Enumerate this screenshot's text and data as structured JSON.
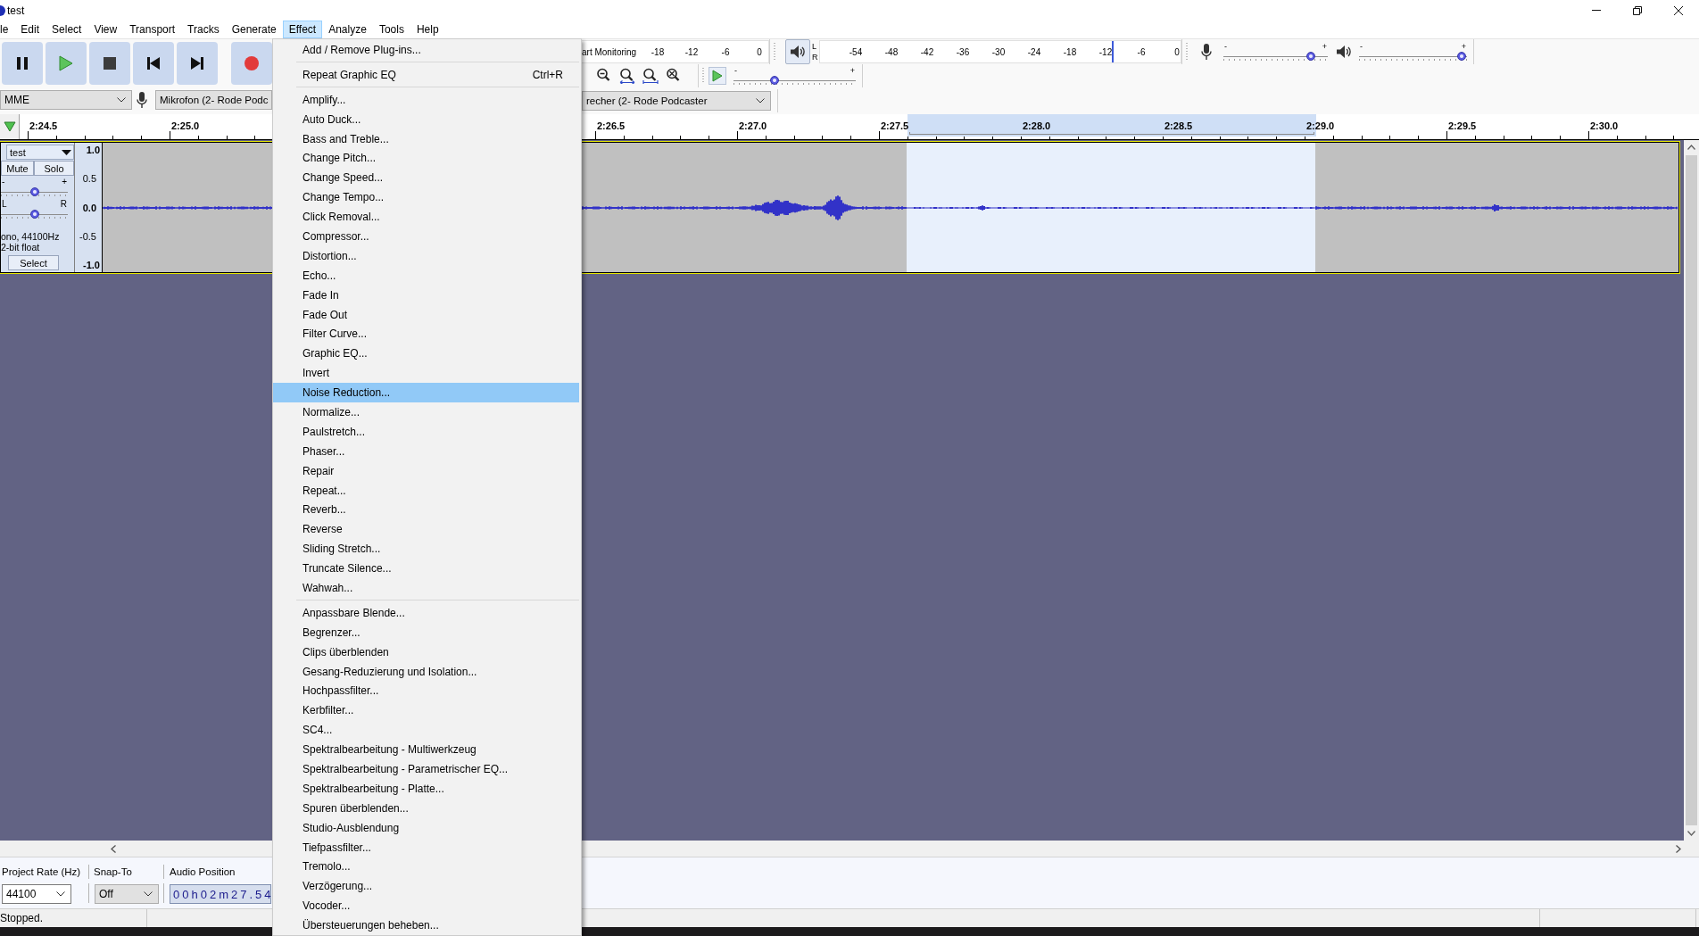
{
  "window": {
    "title": "test"
  },
  "menu_bar": [
    {
      "label": "le",
      "selected": false
    },
    {
      "label": "Edit",
      "selected": false
    },
    {
      "label": "Select",
      "selected": false
    },
    {
      "label": "View",
      "selected": false
    },
    {
      "label": "Transport",
      "selected": false
    },
    {
      "label": "Tracks",
      "selected": false
    },
    {
      "label": "Generate",
      "selected": false
    },
    {
      "label": "Effect",
      "selected": true
    },
    {
      "label": "Analyze",
      "selected": false
    },
    {
      "label": "Tools",
      "selected": false
    },
    {
      "label": "Help",
      "selected": false
    }
  ],
  "meter_toolbar": {
    "recording": {
      "label": "art Monitoring",
      "ticks": [
        "-18",
        "-12",
        "-6",
        "0"
      ]
    },
    "playback": {
      "channels": [
        "L",
        "R"
      ],
      "ticks": [
        "-54",
        "-48",
        "-42",
        "-36",
        "-30",
        "-24",
        "-18",
        "-12",
        "-6",
        "0"
      ],
      "level": 0.81
    }
  },
  "mixer_toolbar": {
    "recording_volume": {
      "min_label": "-",
      "max_label": "+",
      "level": 0.87
    },
    "playback_volume": {
      "min_label": "-",
      "max_label": "+",
      "level": 0.99
    }
  },
  "play_at_speed": {
    "min_label": "-",
    "max_label": "+",
    "level": 0.32
  },
  "device_toolbar": {
    "host": "MME",
    "recording_device": "Mikrofon (2- Rode Podc",
    "playback_device": "recher (2- Rode Podcaster"
  },
  "ruler": {
    "labels_left": [
      "2:24.5",
      "2:25.0"
    ],
    "labels_right": [
      "2:26.5",
      "2:27.0",
      "2:27.5",
      "2:28.0",
      "2:28.5",
      "2:29.0",
      "2:29.5",
      "2:30.0"
    ]
  },
  "track": {
    "name": "test",
    "selected": true,
    "mute_button": "Mute",
    "solo_button": "Solo",
    "gain": {
      "min_label": "-",
      "max_label": "+",
      "level": 0.5
    },
    "pan": {
      "min_label": "L",
      "max_label": "R",
      "level": 0.5
    },
    "info": [
      "ono, 44100Hz",
      "2-bit float"
    ],
    "select_button": "Select",
    "scale": [
      {
        "label": "1.0",
        "major": true
      },
      {
        "label": "0.5",
        "major": false
      },
      {
        "label": "0.0",
        "major": true
      },
      {
        "label": "-0.5",
        "major": false
      },
      {
        "label": "-1.0",
        "major": true
      }
    ]
  },
  "selection_toolbar": {
    "project_rate": {
      "label": "Project Rate (Hz)",
      "value": "44100"
    },
    "snap_to": {
      "label": "Snap-To",
      "value": "Off"
    },
    "audio_position": {
      "label": "Audio Position",
      "value": "00h02m27.54"
    }
  },
  "status_bar": {
    "text": "Stopped."
  },
  "effect_menu": {
    "sections": [
      {
        "items": [
          {
            "label": "Add / Remove Plug-ins...",
            "selected": false
          }
        ]
      },
      {
        "items": [
          {
            "label": "Repeat Graphic EQ",
            "shortcut": "Ctrl+R",
            "selected": false
          }
        ]
      },
      {
        "items": [
          {
            "label": "Amplify...",
            "selected": false
          },
          {
            "label": "Auto Duck...",
            "selected": false
          },
          {
            "label": "Bass and Treble...",
            "selected": false
          },
          {
            "label": "Change Pitch...",
            "selected": false
          },
          {
            "label": "Change Speed...",
            "selected": false
          },
          {
            "label": "Change Tempo...",
            "selected": false
          },
          {
            "label": "Click Removal...",
            "selected": false
          },
          {
            "label": "Compressor...",
            "selected": false
          },
          {
            "label": "Distortion...",
            "selected": false
          },
          {
            "label": "Echo...",
            "selected": false
          },
          {
            "label": "Fade In",
            "selected": false
          },
          {
            "label": "Fade Out",
            "selected": false
          },
          {
            "label": "Filter Curve...",
            "selected": false
          },
          {
            "label": "Graphic EQ...",
            "selected": false
          },
          {
            "label": "Invert",
            "selected": false
          },
          {
            "label": "Noise Reduction...",
            "selected": true
          },
          {
            "label": "Normalize...",
            "selected": false
          },
          {
            "label": "Paulstretch...",
            "selected": false
          },
          {
            "label": "Phaser...",
            "selected": false
          },
          {
            "label": "Repair",
            "selected": false
          },
          {
            "label": "Repeat...",
            "selected": false
          },
          {
            "label": "Reverb...",
            "selected": false
          },
          {
            "label": "Reverse",
            "selected": false
          },
          {
            "label": "Sliding Stretch...",
            "selected": false
          },
          {
            "label": "Truncate Silence...",
            "selected": false
          },
          {
            "label": "Wahwah...",
            "selected": false
          }
        ]
      },
      {
        "items": [
          {
            "label": "Anpassbare Blende...",
            "selected": false
          },
          {
            "label": "Begrenzer...",
            "selected": false
          },
          {
            "label": "Clips überblenden",
            "selected": false
          },
          {
            "label": "Gesang-Reduzierung und Isolation...",
            "selected": false
          },
          {
            "label": "Hochpassfilter...",
            "selected": false
          },
          {
            "label": "Kerbfilter...",
            "selected": false
          },
          {
            "label": "SC4...",
            "selected": false
          },
          {
            "label": "Spektralbearbeitung - Multiwerkzeug",
            "selected": false
          },
          {
            "label": "Spektralbearbeitung - Parametrischer EQ...",
            "selected": false
          },
          {
            "label": "Spektralbearbeitung - Platte...",
            "selected": false
          },
          {
            "label": "Spuren überblenden...",
            "selected": false
          },
          {
            "label": "Studio-Ausblendung",
            "selected": false
          },
          {
            "label": "Tiefpassfilter...",
            "selected": false
          },
          {
            "label": "Tremolo...",
            "selected": false
          },
          {
            "label": "Verzögerung...",
            "selected": false
          },
          {
            "label": "Vocoder...",
            "selected": false
          },
          {
            "label": "Übersteuerungen beheben...",
            "selected": false
          }
        ]
      }
    ]
  }
}
